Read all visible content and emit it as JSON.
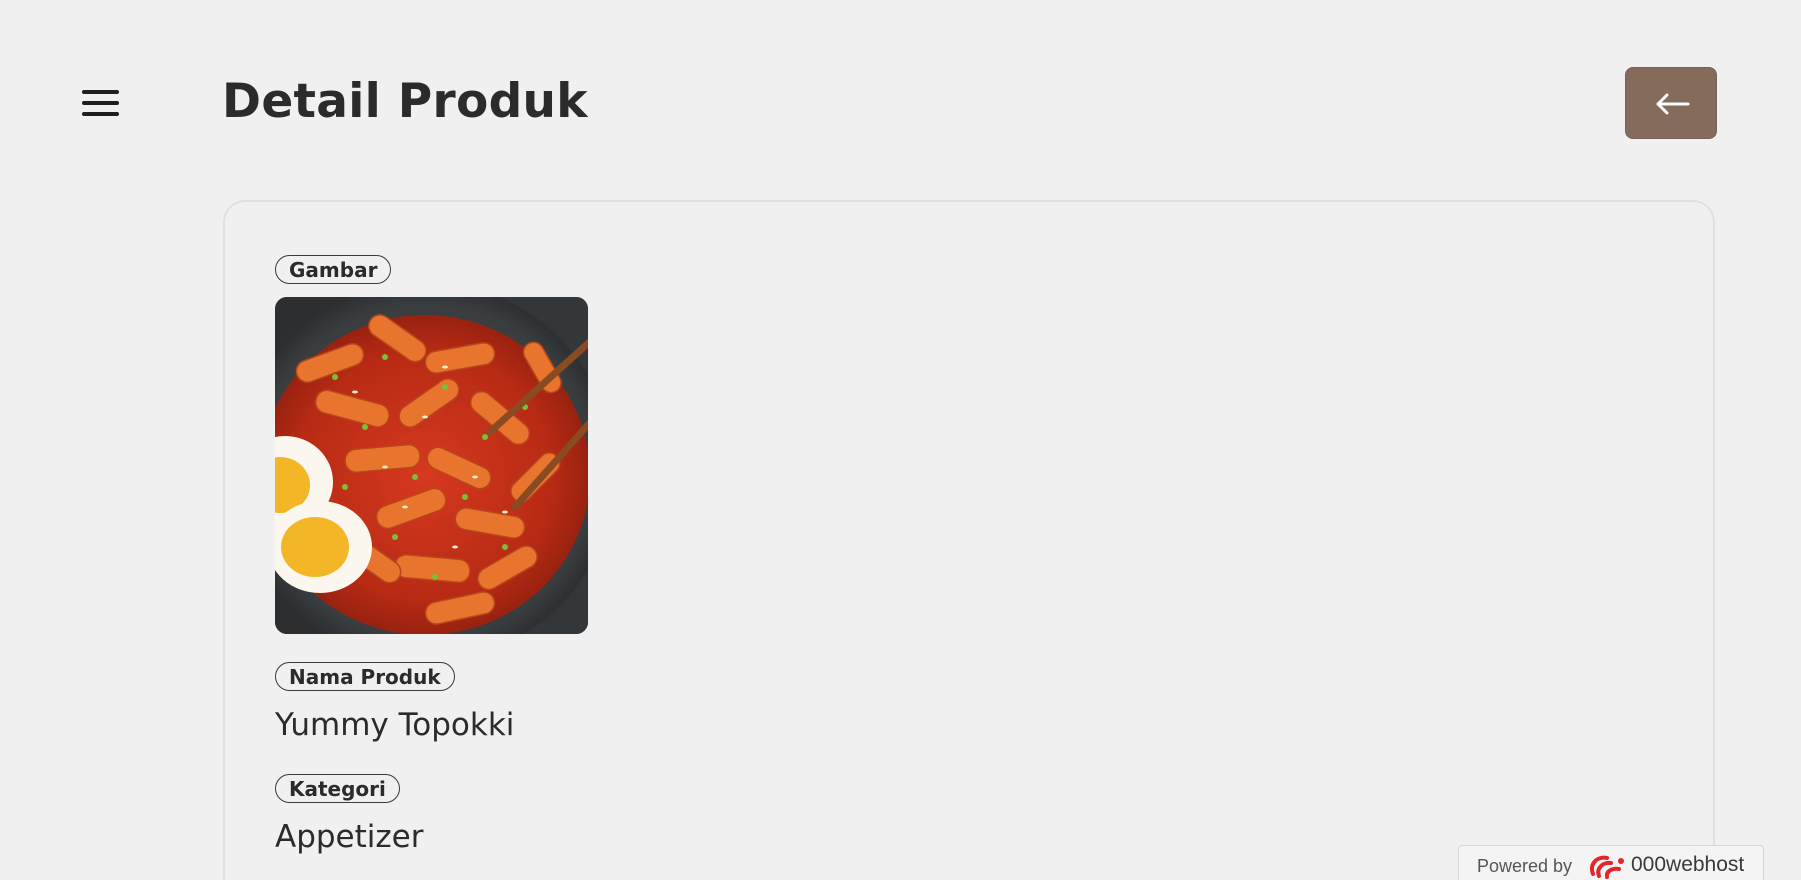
{
  "header": {
    "title": "Detail Produk",
    "menu_icon": "hamburger-menu-icon",
    "back_icon": "arrow-left-icon",
    "back_button_color": "#856b5c"
  },
  "product": {
    "image_label": "Gambar",
    "image_alt": "tteokbokki bowl with boiled eggs and chopsticks",
    "name_label": "Nama Produk",
    "name": "Yummy Topokki",
    "category_label": "Kategori",
    "category": "Appetizer"
  },
  "footer_badge": {
    "powered_by": "Powered by",
    "brand": "000webhost",
    "brand_icon": "000webhost-logo-icon"
  }
}
